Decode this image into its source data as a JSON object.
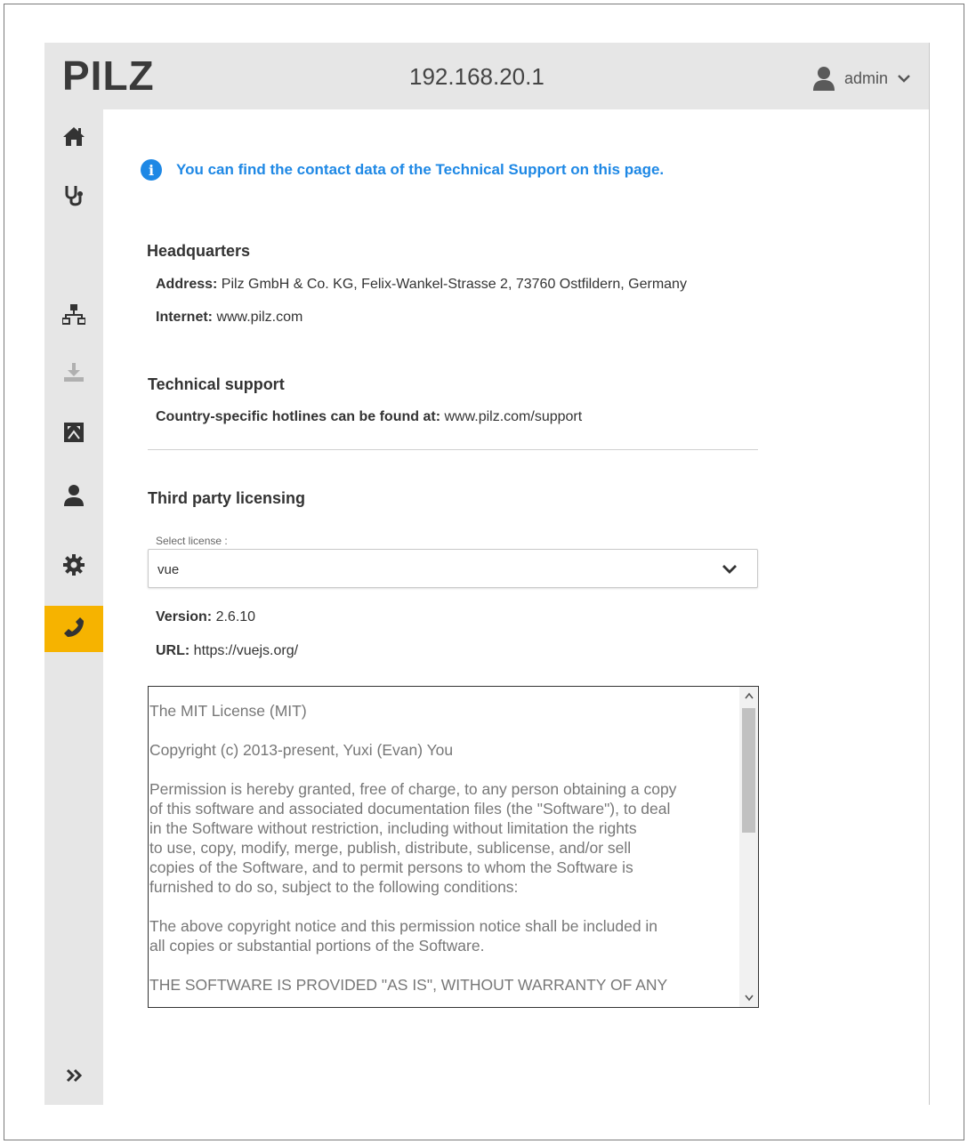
{
  "header": {
    "logo": "PILZ",
    "ip": "192.168.20.1",
    "user": "admin"
  },
  "sidebar": {
    "items": [
      {
        "name": "home",
        "icon": "home-icon"
      },
      {
        "name": "diagnostics",
        "icon": "stethoscope-icon"
      },
      {
        "name": "network",
        "icon": "network-icon"
      },
      {
        "name": "download",
        "icon": "download-icon",
        "disabled": true
      },
      {
        "name": "topology",
        "icon": "topology-icon"
      },
      {
        "name": "user",
        "icon": "user-icon"
      },
      {
        "name": "settings",
        "icon": "gear-icon"
      },
      {
        "name": "support",
        "icon": "phone-icon",
        "active": true
      }
    ],
    "expand_icon": "double-chevron-right-icon"
  },
  "info": {
    "text": "You can find the contact data of the Technical Support on this page."
  },
  "headquarters": {
    "title": "Headquarters",
    "address_label": "Address:",
    "address_value": " Pilz GmbH & Co. KG, Felix-Wankel-Strasse 2, 73760 Ostfildern, Germany",
    "internet_label": "Internet:",
    "internet_value": " www.pilz.com"
  },
  "support": {
    "title": "Technical support",
    "hotline_label": "Country-specific hotlines can be found at:",
    "hotline_value": " www.pilz.com/support"
  },
  "licensing": {
    "title": "Third party licensing",
    "select_label": "Select license :",
    "selected": "vue",
    "version_label": "Version:",
    "version_value": " 2.6.10",
    "url_label": "URL:",
    "url_value": " https://vuejs.org/",
    "license_text": "The MIT License (MIT)\n\nCopyright (c) 2013-present, Yuxi (Evan) You\n\nPermission is hereby granted, free of charge, to any person obtaining a copy\nof this software and associated documentation files (the \"Software\"), to deal\nin the Software without restriction, including without limitation the rights\nto use, copy, modify, merge, publish, distribute, sublicense, and/or sell\ncopies of the Software, and to permit persons to whom the Software is\nfurnished to do so, subject to the following conditions:\n\nThe above copyright notice and this permission notice shall be included in\nall copies or substantial portions of the Software.\n\nTHE SOFTWARE IS PROVIDED \"AS IS\", WITHOUT WARRANTY OF ANY"
  },
  "colors": {
    "accent": "#f6b300",
    "info": "#1e88e5",
    "chrome": "#e6e6e6"
  }
}
